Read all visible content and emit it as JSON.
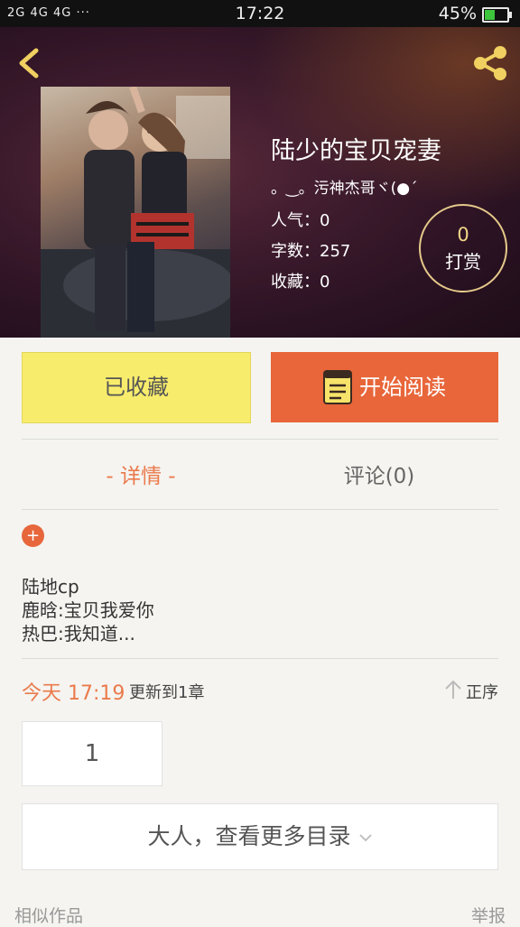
{
  "status": {
    "signal": "2G 4G 4G",
    "dots": "···",
    "time": "17:22",
    "battery": "45%",
    "battery_level": 0.45,
    "battery_color": "#3ec53e"
  },
  "book": {
    "title": "陆少的宝贝宠妻",
    "author": "。‿。污神杰哥ヾ(●´",
    "popularity": "人气：0",
    "wordcount": "字数：257",
    "favorites": "收藏：0",
    "reward_count": "0",
    "reward_label": "打赏"
  },
  "actions": {
    "favorited_label": "已收藏",
    "read_label": "开始阅读"
  },
  "tabs": {
    "detail": "- 详情 -",
    "comments": "评论(0)"
  },
  "description": {
    "expand": "+",
    "lines": [
      "陆地cp",
      "鹿晗:宝贝我爱你",
      "热巴:我知道..."
    ]
  },
  "update": {
    "date": "今天 17:19",
    "text": "更新到1章",
    "sort_label": "正序"
  },
  "chapters": {
    "first": "1",
    "more_label": "大人，查看更多目录"
  },
  "footer": {
    "similar": "相似作品",
    "report": "举报"
  },
  "colors": {
    "accent": "#e8663a",
    "favorite_bg": "#f8ec6c",
    "tab_active": "#ea7a4c"
  }
}
